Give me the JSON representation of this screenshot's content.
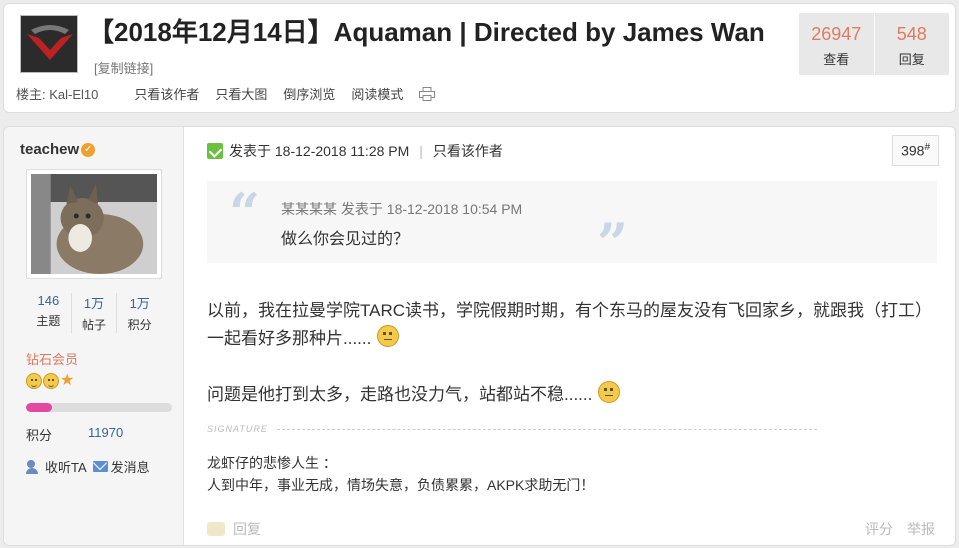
{
  "thread": {
    "title": "【2018年12月14日】Aquaman | Directed by James Wan",
    "copy_link": "[复制链接]",
    "views": "26947",
    "views_label": "查看",
    "replies": "548",
    "replies_label": "回复",
    "op_label": "楼主: Kal-El10",
    "links": [
      "只看该作者",
      "只看大图",
      "倒序浏览",
      "阅读模式"
    ],
    "print_icon": "print-icon"
  },
  "author": {
    "name": "teachew",
    "badge_icon": "verified-icon",
    "topics": "146",
    "topics_label": "主题",
    "posts": "1万",
    "posts_label": "帖子",
    "credits": "1万",
    "credits_label": "积分",
    "rank": "钻石会员",
    "level_progress": 0.18,
    "points_label": "积分",
    "points_value": "11970",
    "follow": "收听TA",
    "message": "发消息"
  },
  "post": {
    "posted_label": "发表于 18-12-2018 11:28 PM",
    "author_only": "只看该作者",
    "separator": "|",
    "floor": "398",
    "floor_sup": "#",
    "quote_meta": "某某某某 发表于 18-12-2018 10:54 PM",
    "quote_text": "做么你会见过的？",
    "para1": "以前，我在拉曼学院TARC读书，学院假期时期，有个东马的屋友没有飞回家乡，就跟我（打工）一起看好多那种片......",
    "para2": "问题是他打到太多，走路也没力气，站都站不稳......",
    "signature_label": "SIGNATURE",
    "sig_line1": "龙虾仔的悲惨人生 ：",
    "sig_line2": "人到中年，事业无成，情场失意，负债累累，AKPK求助无门！",
    "reply": "回复",
    "rate": "评分",
    "report": "举报"
  }
}
